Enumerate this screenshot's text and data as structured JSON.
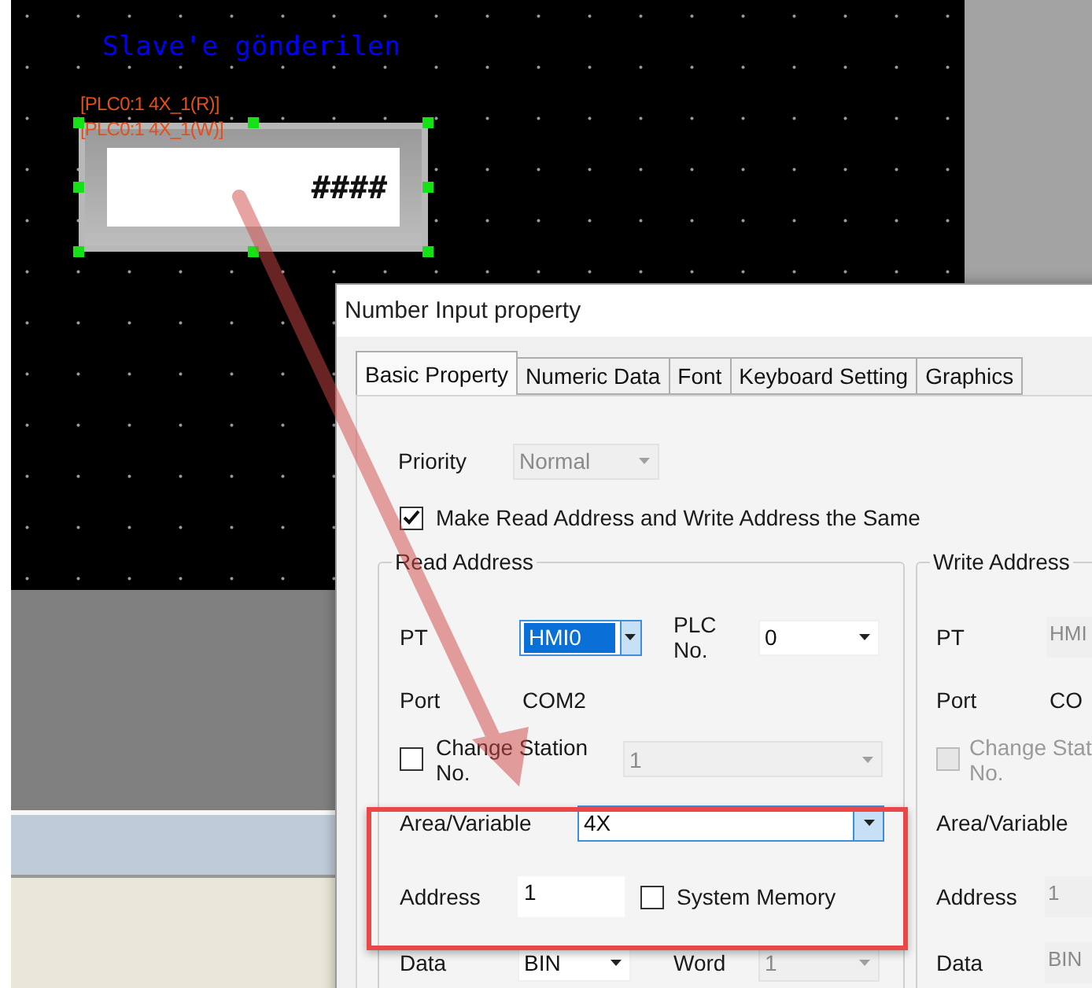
{
  "canvas": {
    "title": "Slave'e gönderilen",
    "object": {
      "read_tag": "[PLC0:1 4X_1(R)]",
      "write_tag": "[PLC0:1 4X_1(W)]",
      "value": "####",
      "selected": true
    }
  },
  "dialog": {
    "title": "Number Input property",
    "tabs": [
      {
        "label": "Basic Property",
        "selected": true
      },
      {
        "label": "Numeric Data",
        "selected": false
      },
      {
        "label": "Font",
        "selected": false
      },
      {
        "label": "Keyboard Setting",
        "selected": false
      },
      {
        "label": "Graphics",
        "selected": false
      }
    ],
    "priority": {
      "label": "Priority",
      "value": "Normal",
      "disabled": true
    },
    "same_address": {
      "label": "Make Read Address and Write Address the Same",
      "checked": true
    },
    "read_address": {
      "title": "Read Address",
      "disabled": false,
      "pt": {
        "label": "PT",
        "value": "HMI0",
        "focused": true
      },
      "plc_no": {
        "label": "PLC No.",
        "value": "0"
      },
      "port": {
        "label": "Port",
        "value": "COM2"
      },
      "change_station": {
        "label": "Change Station No.",
        "checked": false,
        "value": "1"
      },
      "area": {
        "label": "Area/Variable",
        "value": "4X",
        "focused": true
      },
      "address": {
        "label": "Address",
        "value": "1"
      },
      "system_memory": {
        "label": "System Memory",
        "checked": false
      },
      "data": {
        "label": "Data",
        "value": "BIN"
      },
      "word": {
        "label": "Word",
        "value": "1"
      }
    },
    "write_address": {
      "title": "Write Address",
      "disabled": true,
      "pt": {
        "label": "PT",
        "value": "HMI"
      },
      "port": {
        "label": "Port",
        "value": "CO"
      },
      "change_station": {
        "label": "Change Stat No.",
        "checked": false
      },
      "area": {
        "label": "Area/Variable"
      },
      "address": {
        "label": "Address",
        "value": "1"
      },
      "data": {
        "label": "Data",
        "value": "BIN"
      }
    }
  }
}
